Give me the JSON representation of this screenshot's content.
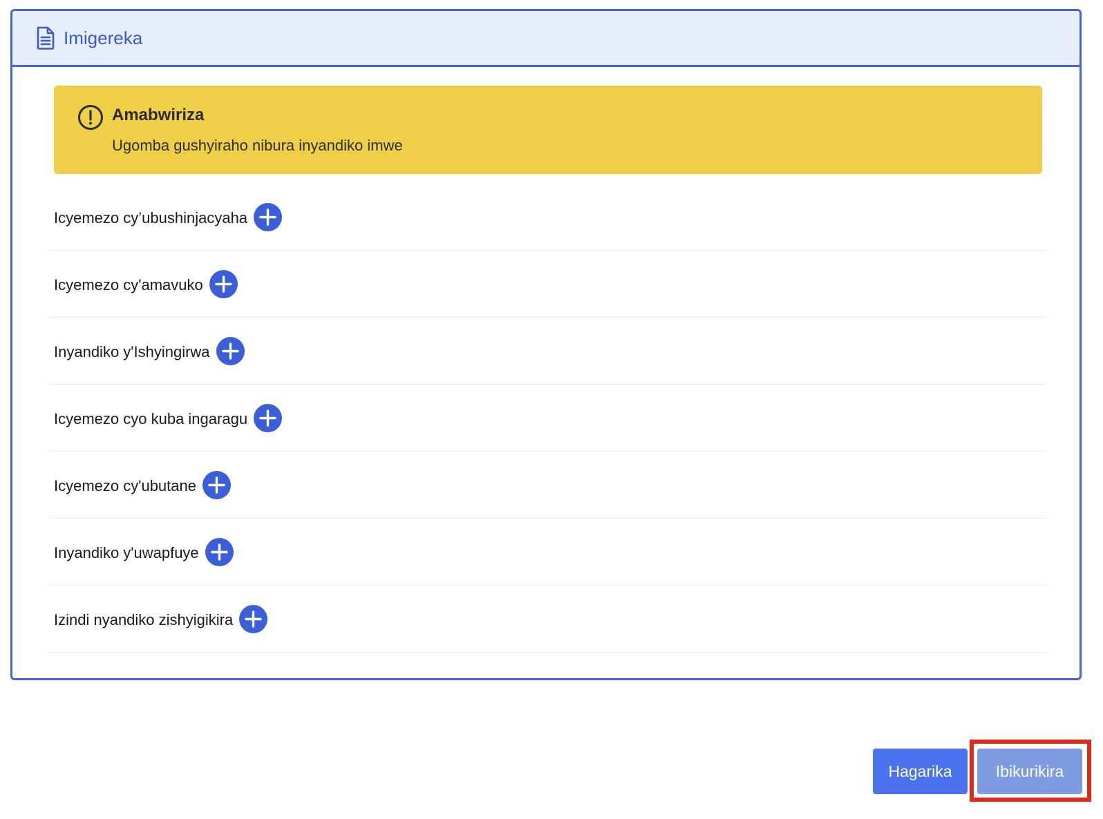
{
  "section": {
    "title": "Imigereka",
    "icon": "document-icon"
  },
  "notice": {
    "icon": "exclamation-circle-icon",
    "title": "Amabwiriza",
    "text": "Ugomba gushyiraho nibura inyandiko imwe",
    "color": "#f0cf48"
  },
  "documents": [
    {
      "label": "Icyemezo cy’ubushinjacyaha"
    },
    {
      "label": "Icyemezo cy'amavuko"
    },
    {
      "label": "Inyandiko y'Ishyingirwa"
    },
    {
      "label": "Icyemezo cyo kuba ingaragu"
    },
    {
      "label": "Icyemezo cy'ubutane"
    },
    {
      "label": "Inyandiko y'uwapfuye"
    },
    {
      "label": "Izindi nyandiko zishyigikira"
    }
  ],
  "add_icon": "plus-circle-icon",
  "footer": {
    "cancel_label": "Hagarika",
    "submit_label": "Ibikurikira"
  },
  "colors": {
    "accent": "#4464d6",
    "header_bg": "#e6edfb",
    "primary_button": "#4a72ee",
    "submit_button": "#7d9be0",
    "highlight": "#e1261c"
  }
}
